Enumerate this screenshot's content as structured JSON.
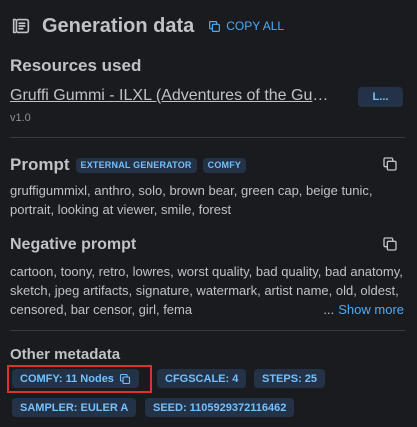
{
  "header": {
    "title": "Generation data",
    "copy_all_label": "COPY ALL",
    "icon": "info-panel-icon"
  },
  "resources": {
    "title": "Resources used",
    "items": [
      {
        "name": "Gruffi Gummi - ILXL (Adventures of the Gum...",
        "version": "v1.0",
        "badge": "L..."
      }
    ]
  },
  "prompt": {
    "title": "Prompt",
    "tags": [
      "EXTERNAL GENERATOR",
      "COMFY"
    ],
    "text": "gruffigummixl, anthro, solo, brown bear, green cap, beige tunic, portrait, looking at viewer, smile, forest"
  },
  "negative_prompt": {
    "title": "Negative prompt",
    "text": "cartoon, toony, retro, lowres, worst quality, bad quality, bad anatomy, sketch, jpeg artifacts, signature, watermark, artist name, old, oldest, censored, bar censor, girl, fema",
    "ellipsis": "...",
    "show_more_label": "Show more"
  },
  "metadata": {
    "title": "Other metadata",
    "badges": [
      "COMFY: 11 Nodes",
      "CFGSCALE: 4",
      "STEPS: 25",
      "SAMPLER: EULER A",
      "SEED: 1105929372116462"
    ]
  },
  "colors": {
    "background": "#1a1b1e",
    "accent": "#4dabf7",
    "badge_bg": "#243247",
    "highlight": "#e03131"
  }
}
